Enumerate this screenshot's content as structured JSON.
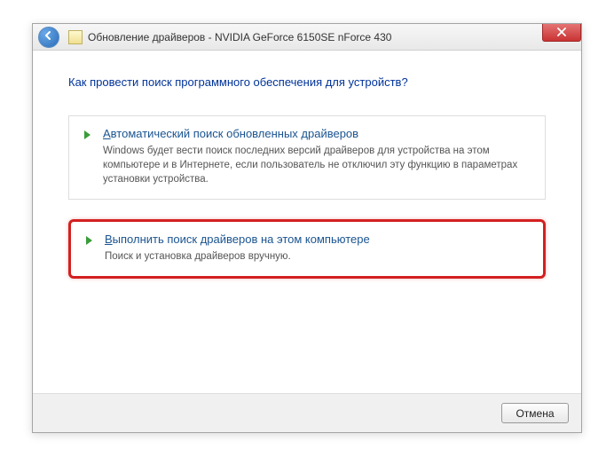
{
  "window": {
    "title": "Обновление драйверов - NVIDIA GeForce 6150SE nForce 430"
  },
  "heading": "Как провести поиск программного обеспечения для устройств?",
  "options": {
    "auto": {
      "title_first_char": "А",
      "title_rest": "втоматический поиск обновленных драйверов",
      "desc": "Windows будет вести поиск последних версий драйверов для устройства на этом компьютере и в Интернете, если пользователь не отключил эту функцию в параметрах установки устройства."
    },
    "manual": {
      "title_first_char": "В",
      "title_rest": "ыполнить поиск драйверов на этом компьютере",
      "desc": "Поиск и установка драйверов вручную."
    }
  },
  "footer": {
    "cancel": "Отмена"
  }
}
